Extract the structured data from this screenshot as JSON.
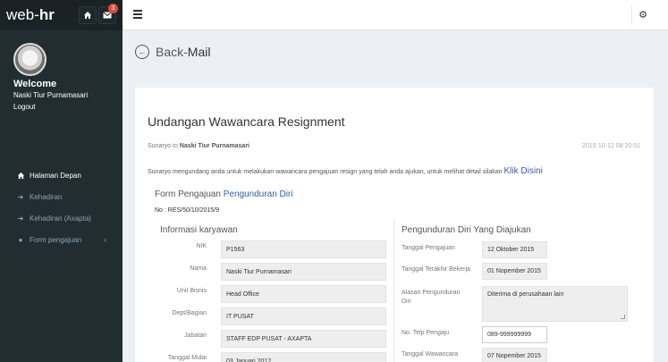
{
  "brand": {
    "prefix": "web",
    "dot": "-",
    "suffix": "hr"
  },
  "notifications": {
    "count": "3"
  },
  "user": {
    "welcome": "Welcome",
    "name": "Naski Tiur Purnamasari",
    "logout": "Logout"
  },
  "menu": [
    {
      "label": "Halaman Depan",
      "icon": "home-icon"
    },
    {
      "label": "Kehadiran",
      "icon": "sign-in-icon"
    },
    {
      "label": "Kehadiran (Axapta)",
      "icon": "sign-in-icon"
    },
    {
      "label": "Form pengajuan",
      "icon": "circle-icon",
      "chevron": "‹"
    }
  ],
  "nav": {
    "back": "Back-",
    "section": "Mail"
  },
  "mail": {
    "subject": "Undangan Wawancara Resignment",
    "from": "Sunaryo",
    "to_word": "to",
    "to": "Naski Tiur Purnamasari",
    "date": "2015-10-12 08:20:01",
    "body": "Sunaryo mengundang anda untuk melakukan wawancara pengajuan resign yang telah anda ajukan, untuk melihat detail silakan",
    "link": "Klik Disini"
  },
  "form": {
    "title_prefix": "Form Pengajuan",
    "title_highlight": "Pengunduran Diri",
    "number": "No : RES/50/10/2015/9"
  },
  "left_section": {
    "title": "Informasi karyawan",
    "fields": [
      {
        "label": "NIK",
        "value": "P1563"
      },
      {
        "label": "Nama",
        "value": "Naski Tiur Purnamasari"
      },
      {
        "label": "Unit Bisnis",
        "value": "Head Office"
      },
      {
        "label": "Dept/Bagian",
        "value": "IT PUSAT"
      },
      {
        "label": "Jabatan",
        "value": "STAFF EDP PUSAT - AXAPTA"
      },
      {
        "label": "Tanggal Mulai",
        "value": "03 Januari 2012"
      }
    ]
  },
  "right_section": {
    "title": "Pengunduran Diri Yang Diajukan",
    "fields": [
      {
        "label": "Tanggal Pengajuan",
        "value": "12 Oktober 2015"
      },
      {
        "label": "Tanggal Terakhir Bekerja",
        "value": "01 Nopember 2015"
      },
      {
        "label": "Alasan Pengunduran Diri",
        "value": "Diterima di perusahaan lain"
      },
      {
        "label": "No. Telp Pengaju",
        "value": "089-999999999"
      },
      {
        "label": "Tanggal Wawancara",
        "value": "07 Nopember 2015"
      }
    ]
  }
}
